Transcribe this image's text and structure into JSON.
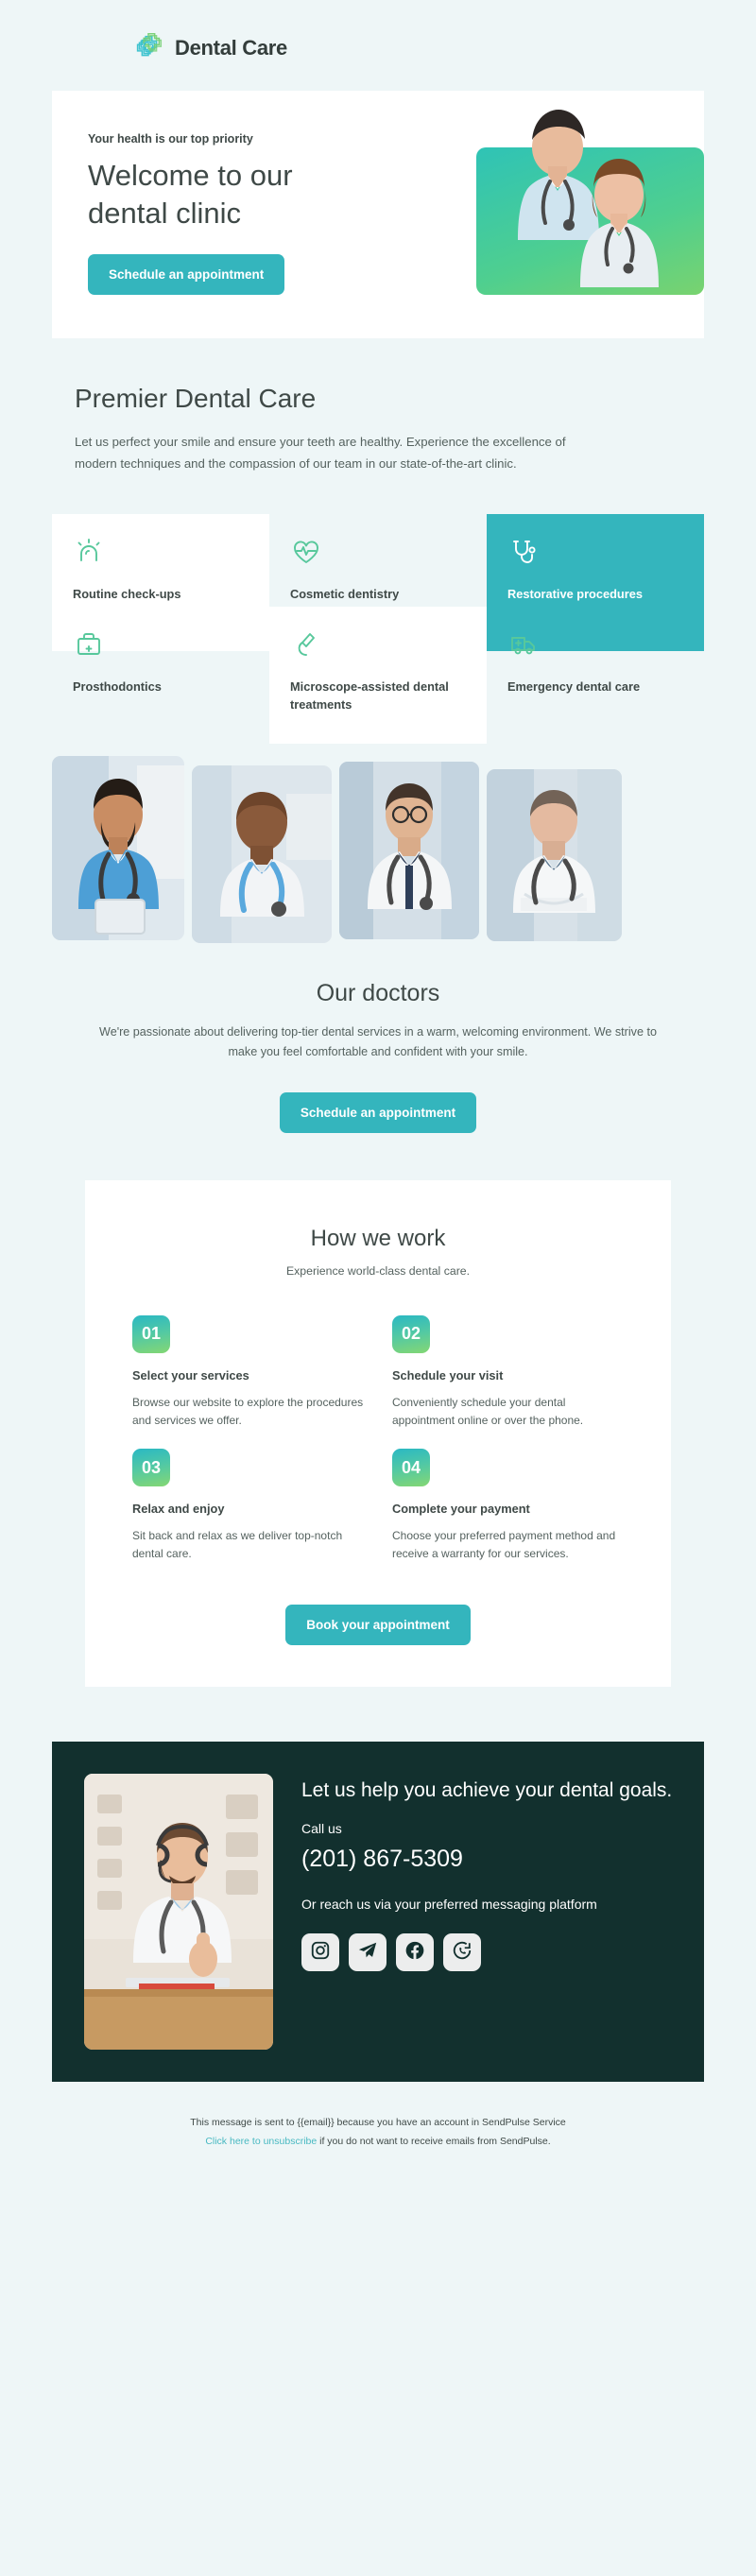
{
  "brand": {
    "name": "Dental Care",
    "logo_icon": "dental-cross-logo",
    "accent_color": "#34b5bd",
    "gradient_start": "#2ab8c4",
    "gradient_end": "#84d773",
    "page_background": "#eef6f7",
    "dark_section_color": "#12302e"
  },
  "hero": {
    "kicker": "Your health is our top priority",
    "title_line1": "Welcome to our",
    "title_line2": "dental clinic",
    "cta_label": "Schedule an appointment",
    "image_alt": "two smiling dentists"
  },
  "premier": {
    "title": "Premier Dental Care",
    "description": "Let us perfect your smile and ensure your teeth are healthy. Experience the excellence of modern techniques and the compassion of our team in our state-of-the-art clinic."
  },
  "services": [
    {
      "label": "Routine check-ups",
      "icon": "tooth-lamp-icon",
      "style": "white"
    },
    {
      "label": "Cosmetic dentistry",
      "icon": "heart-pulse-icon",
      "style": "clear"
    },
    {
      "label": "Restorative procedures",
      "icon": "stethoscope-icon",
      "style": "accent"
    },
    {
      "label": "Prosthodontics",
      "icon": "medical-case-icon",
      "style": "clear"
    },
    {
      "label": "Microscope-assisted dental treatments",
      "icon": "microscope-icon",
      "style": "white"
    },
    {
      "label": "Emergency dental care",
      "icon": "ambulance-icon",
      "style": "clear"
    }
  ],
  "doctor_photos": [
    {
      "alt": "dentist in blue scrubs holding tablet"
    },
    {
      "alt": "smiling doctor in white coat with blue stethoscope"
    },
    {
      "alt": "doctor with glasses and stethoscope"
    },
    {
      "alt": "doctor with arms crossed in white coat"
    }
  ],
  "our_doctors": {
    "title": "Our doctors",
    "description": "We're passionate about delivering top-tier dental services in a warm, welcoming environment. We strive to make you feel comfortable and confident with your smile.",
    "cta_label": "Schedule an appointment"
  },
  "how_we_work": {
    "title": "How we work",
    "subtitle": "Experience world-class dental care.",
    "cta_label": "Book your appointment",
    "steps": [
      {
        "number": "01",
        "title": "Select your services",
        "description": "Browse our website to explore the procedures and services we offer."
      },
      {
        "number": "02",
        "title": "Schedule your visit",
        "description": "Conveniently schedule your dental appointment online or over the phone."
      },
      {
        "number": "03",
        "title": "Relax and enjoy",
        "description": "Sit back and relax as we deliver top-notch dental care."
      },
      {
        "number": "04",
        "title": "Complete your payment",
        "description": "Choose your preferred payment method and receive a warranty for our services."
      }
    ]
  },
  "contact": {
    "heading": "Let us help you achieve your dental goals.",
    "call_label": "Call us",
    "phone": "(201) 867-5309",
    "messaging_text": "Or reach us via your preferred messaging platform",
    "photo_alt": "doctor with headset giving thumbs up",
    "socials": [
      {
        "name": "instagram-icon",
        "label": "Instagram"
      },
      {
        "name": "telegram-icon",
        "label": "Telegram"
      },
      {
        "name": "facebook-icon",
        "label": "Facebook"
      },
      {
        "name": "whatsapp-icon",
        "label": "WhatsApp"
      }
    ]
  },
  "footer": {
    "line1": "This message is sent to {{email}} because you have an account in SendPulse Service",
    "unsubscribe_link": "Click here to unsubscribe",
    "line2_rest": " if you do not want to receive emails from SendPulse."
  }
}
